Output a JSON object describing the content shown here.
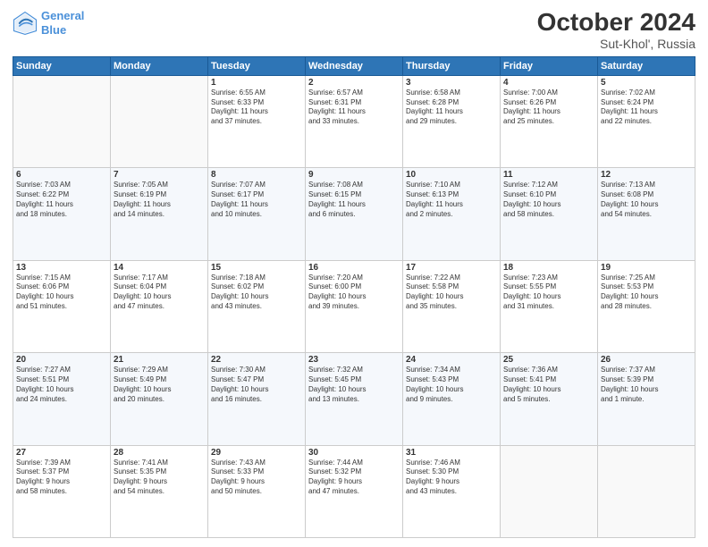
{
  "logo": {
    "line1": "General",
    "line2": "Blue"
  },
  "title": "October 2024",
  "subtitle": "Sut-Khol', Russia",
  "days_header": [
    "Sunday",
    "Monday",
    "Tuesday",
    "Wednesday",
    "Thursday",
    "Friday",
    "Saturday"
  ],
  "weeks": [
    [
      {
        "day": "",
        "info": ""
      },
      {
        "day": "",
        "info": ""
      },
      {
        "day": "1",
        "info": "Sunrise: 6:55 AM\nSunset: 6:33 PM\nDaylight: 11 hours\nand 37 minutes."
      },
      {
        "day": "2",
        "info": "Sunrise: 6:57 AM\nSunset: 6:31 PM\nDaylight: 11 hours\nand 33 minutes."
      },
      {
        "day": "3",
        "info": "Sunrise: 6:58 AM\nSunset: 6:28 PM\nDaylight: 11 hours\nand 29 minutes."
      },
      {
        "day": "4",
        "info": "Sunrise: 7:00 AM\nSunset: 6:26 PM\nDaylight: 11 hours\nand 25 minutes."
      },
      {
        "day": "5",
        "info": "Sunrise: 7:02 AM\nSunset: 6:24 PM\nDaylight: 11 hours\nand 22 minutes."
      }
    ],
    [
      {
        "day": "6",
        "info": "Sunrise: 7:03 AM\nSunset: 6:22 PM\nDaylight: 11 hours\nand 18 minutes."
      },
      {
        "day": "7",
        "info": "Sunrise: 7:05 AM\nSunset: 6:19 PM\nDaylight: 11 hours\nand 14 minutes."
      },
      {
        "day": "8",
        "info": "Sunrise: 7:07 AM\nSunset: 6:17 PM\nDaylight: 11 hours\nand 10 minutes."
      },
      {
        "day": "9",
        "info": "Sunrise: 7:08 AM\nSunset: 6:15 PM\nDaylight: 11 hours\nand 6 minutes."
      },
      {
        "day": "10",
        "info": "Sunrise: 7:10 AM\nSunset: 6:13 PM\nDaylight: 11 hours\nand 2 minutes."
      },
      {
        "day": "11",
        "info": "Sunrise: 7:12 AM\nSunset: 6:10 PM\nDaylight: 10 hours\nand 58 minutes."
      },
      {
        "day": "12",
        "info": "Sunrise: 7:13 AM\nSunset: 6:08 PM\nDaylight: 10 hours\nand 54 minutes."
      }
    ],
    [
      {
        "day": "13",
        "info": "Sunrise: 7:15 AM\nSunset: 6:06 PM\nDaylight: 10 hours\nand 51 minutes."
      },
      {
        "day": "14",
        "info": "Sunrise: 7:17 AM\nSunset: 6:04 PM\nDaylight: 10 hours\nand 47 minutes."
      },
      {
        "day": "15",
        "info": "Sunrise: 7:18 AM\nSunset: 6:02 PM\nDaylight: 10 hours\nand 43 minutes."
      },
      {
        "day": "16",
        "info": "Sunrise: 7:20 AM\nSunset: 6:00 PM\nDaylight: 10 hours\nand 39 minutes."
      },
      {
        "day": "17",
        "info": "Sunrise: 7:22 AM\nSunset: 5:58 PM\nDaylight: 10 hours\nand 35 minutes."
      },
      {
        "day": "18",
        "info": "Sunrise: 7:23 AM\nSunset: 5:55 PM\nDaylight: 10 hours\nand 31 minutes."
      },
      {
        "day": "19",
        "info": "Sunrise: 7:25 AM\nSunset: 5:53 PM\nDaylight: 10 hours\nand 28 minutes."
      }
    ],
    [
      {
        "day": "20",
        "info": "Sunrise: 7:27 AM\nSunset: 5:51 PM\nDaylight: 10 hours\nand 24 minutes."
      },
      {
        "day": "21",
        "info": "Sunrise: 7:29 AM\nSunset: 5:49 PM\nDaylight: 10 hours\nand 20 minutes."
      },
      {
        "day": "22",
        "info": "Sunrise: 7:30 AM\nSunset: 5:47 PM\nDaylight: 10 hours\nand 16 minutes."
      },
      {
        "day": "23",
        "info": "Sunrise: 7:32 AM\nSunset: 5:45 PM\nDaylight: 10 hours\nand 13 minutes."
      },
      {
        "day": "24",
        "info": "Sunrise: 7:34 AM\nSunset: 5:43 PM\nDaylight: 10 hours\nand 9 minutes."
      },
      {
        "day": "25",
        "info": "Sunrise: 7:36 AM\nSunset: 5:41 PM\nDaylight: 10 hours\nand 5 minutes."
      },
      {
        "day": "26",
        "info": "Sunrise: 7:37 AM\nSunset: 5:39 PM\nDaylight: 10 hours\nand 1 minute."
      }
    ],
    [
      {
        "day": "27",
        "info": "Sunrise: 7:39 AM\nSunset: 5:37 PM\nDaylight: 9 hours\nand 58 minutes."
      },
      {
        "day": "28",
        "info": "Sunrise: 7:41 AM\nSunset: 5:35 PM\nDaylight: 9 hours\nand 54 minutes."
      },
      {
        "day": "29",
        "info": "Sunrise: 7:43 AM\nSunset: 5:33 PM\nDaylight: 9 hours\nand 50 minutes."
      },
      {
        "day": "30",
        "info": "Sunrise: 7:44 AM\nSunset: 5:32 PM\nDaylight: 9 hours\nand 47 minutes."
      },
      {
        "day": "31",
        "info": "Sunrise: 7:46 AM\nSunset: 5:30 PM\nDaylight: 9 hours\nand 43 minutes."
      },
      {
        "day": "",
        "info": ""
      },
      {
        "day": "",
        "info": ""
      }
    ]
  ]
}
